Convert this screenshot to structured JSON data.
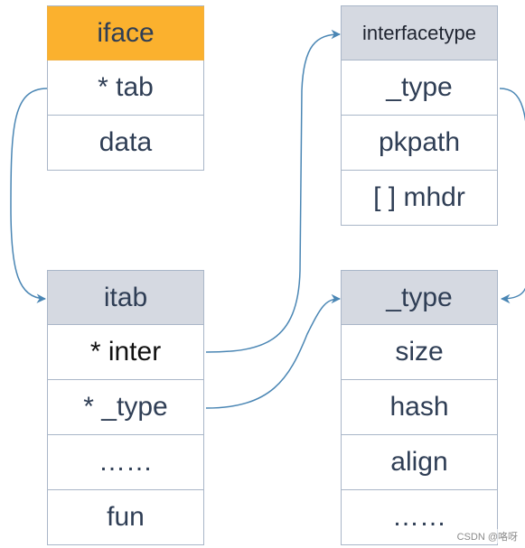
{
  "structs": {
    "iface": {
      "title": "iface",
      "fields": [
        "* tab",
        "data"
      ]
    },
    "itab": {
      "title": "itab",
      "fields": [
        "* inter",
        "* _type",
        "……",
        "fun"
      ]
    },
    "interfacetype": {
      "title": "interfacetype",
      "fields": [
        "_type",
        "pkpath",
        "[ ] mhdr"
      ]
    },
    "type": {
      "title": "_type",
      "fields": [
        "size",
        "hash",
        "align",
        "……"
      ]
    }
  },
  "edges": [
    {
      "from": "iface.tab",
      "to": "itab"
    },
    {
      "from": "itab.inter",
      "to": "interfacetype"
    },
    {
      "from": "itab._type",
      "to": "_type"
    },
    {
      "from": "interfacetype._type",
      "to": "_type"
    }
  ],
  "colors": {
    "header_orange": "#fbb12e",
    "header_gray": "#d5d9e1",
    "arrow": "#4a86b4"
  },
  "watermark": "CSDN @咯呀"
}
